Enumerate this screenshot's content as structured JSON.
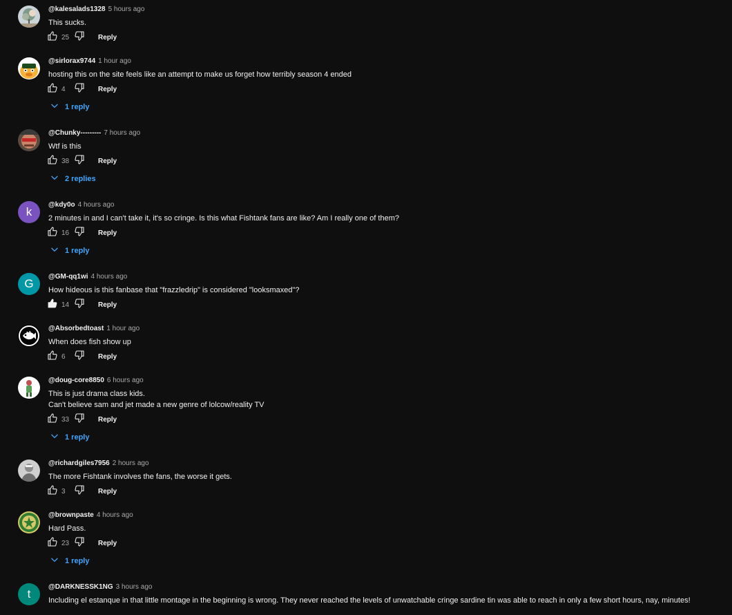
{
  "ui": {
    "reply_label": "Reply"
  },
  "comments": [
    {
      "author": "@kalesalads1328",
      "time": "5 hours ago",
      "lines": [
        "This sucks."
      ],
      "likes": "25",
      "replies": "",
      "avatar": {
        "kind": "image",
        "icon": "tree-photo-icon",
        "color": "#8b9aa0"
      }
    },
    {
      "author": "@sirlorax9744",
      "time": "1 hour ago",
      "lines": [
        "hosting this on the site feels like an attempt to make us forget how terribly season 4 ended"
      ],
      "likes": "4",
      "replies": "1 reply",
      "avatar": {
        "kind": "image",
        "icon": "cartoon-duck-icon",
        "color": "#f0b030"
      }
    },
    {
      "author": "@Chunky---------",
      "time": "7 hours ago",
      "lines": [
        "Wtf is this"
      ],
      "likes": "38",
      "replies": "2 replies",
      "avatar": {
        "kind": "image",
        "icon": "face-photo-icon",
        "color": "#b04030"
      }
    },
    {
      "author": "@kdy0o",
      "time": "4 hours ago",
      "lines": [
        "2 minutes in and I can't take it, it's so cringe. Is this what Fishtank fans are like? Am I really one of them?"
      ],
      "likes": "16",
      "replies": "1 reply",
      "avatar": {
        "kind": "letter",
        "letter": "k",
        "color": "#7b53c1"
      }
    },
    {
      "author": "@GM-qq1wi",
      "time": "4 hours ago",
      "lines": [
        "How hideous is this fanbase that \"frazzledrip\" is considered \"looksmaxed\"?"
      ],
      "likes": "14",
      "replies": "",
      "liked": true,
      "avatar": {
        "kind": "letter",
        "letter": "G",
        "color": "#0097a7"
      }
    },
    {
      "author": "@Absorbedtoast",
      "time": "1 hour ago",
      "lines": [
        "When does fish show up"
      ],
      "likes": "6",
      "replies": "",
      "avatar": {
        "kind": "image",
        "icon": "fish-logo-icon",
        "color": "#111111"
      }
    },
    {
      "author": "@doug-core8850",
      "time": "6 hours ago",
      "lines": [
        "This is just drama class kids.",
        "Can't believe sam and jet made a new genre of lolcow/reality TV"
      ],
      "likes": "33",
      "replies": "1 reply",
      "avatar": {
        "kind": "image",
        "icon": "cartoon-character-icon",
        "color": "#f2f2f2"
      }
    },
    {
      "author": "@richardgiles7956",
      "time": "2 hours ago",
      "lines": [
        "The more Fishtank involves the fans, the worse it gets."
      ],
      "likes": "3",
      "replies": "",
      "avatar": {
        "kind": "image",
        "icon": "portrait-photo-icon",
        "color": "#9a9a9a"
      }
    },
    {
      "author": "@brownpaste",
      "time": "4 hours ago",
      "lines": [
        "Hard Pass."
      ],
      "likes": "23",
      "replies": "1 reply",
      "avatar": {
        "kind": "image",
        "icon": "emblem-badge-icon",
        "color": "#2e7d32"
      }
    },
    {
      "author": "@DARKNESSK1NG",
      "time": "3 hours ago",
      "lines": [
        "Including el estanque in that little montage in the beginning is wrong. They never reached the levels of unwatchable cringe sardine tin was able to reach in only a few short hours, nay, minutes!"
      ],
      "likes": "",
      "replies": "",
      "avatar": {
        "kind": "letter",
        "letter": "t",
        "color": "#00897b"
      }
    }
  ]
}
